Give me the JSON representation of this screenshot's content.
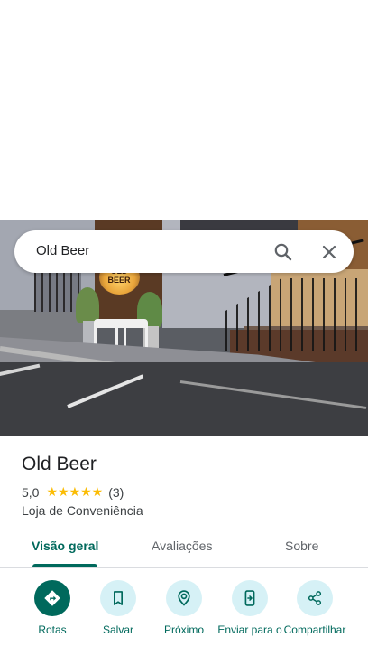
{
  "search": {
    "query": "Old Beer"
  },
  "photo": {
    "sign_text": "OLD BEER"
  },
  "place": {
    "name": "Old Beer",
    "rating": "5,0",
    "stars": "★★★★★",
    "review_count": "(3)",
    "category": "Loja de Conveniência"
  },
  "tabs": [
    {
      "label": "Visão geral",
      "active": true
    },
    {
      "label": "Avaliações",
      "active": false
    },
    {
      "label": "Sobre",
      "active": false
    }
  ],
  "actions": [
    {
      "label": "Rotas",
      "icon": "directions-icon"
    },
    {
      "label": "Salvar",
      "icon": "bookmark-icon"
    },
    {
      "label": "Próximo",
      "icon": "nearby-icon"
    },
    {
      "label": "Enviar para o",
      "icon": "send-to-phone-icon"
    },
    {
      "label": "Compartilhar",
      "icon": "share-icon"
    }
  ],
  "colors": {
    "accent": "#00695c",
    "action_bg": "#d6f1f6",
    "star": "#fbbc04"
  }
}
